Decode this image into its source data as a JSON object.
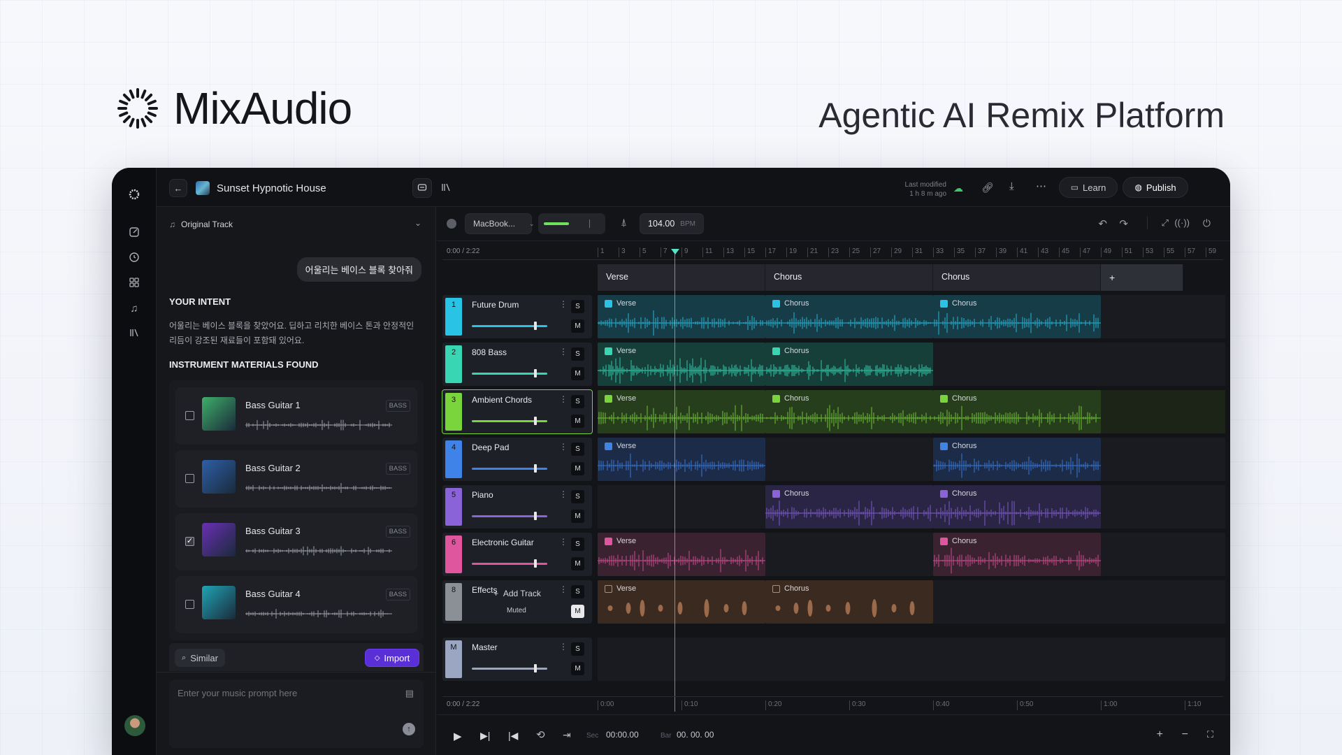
{
  "brand": {
    "name": "MixAudio",
    "tagline": "Agentic AI Remix Platform"
  },
  "topbar": {
    "project_title": "Sunset Hypnotic House",
    "last_modified_label": "Last modified",
    "last_modified_value": "1 h 8 m ago",
    "learn_label": "Learn",
    "publish_label": "Publish"
  },
  "left_pane": {
    "original_track_label": "Original Track",
    "user_message": "어울리는 베이스 블록 찾아줘",
    "intent_heading": "YOUR INTENT",
    "intent_text": "어울리는 베이스 블록을 찾았어요. 딥하고 리치한 베이스 톤과 안정적인 리듬이 강조된 재료들이 포함돼 있어요.",
    "materials_heading": "INSTRUMENT MATERIALS FOUND",
    "materials": [
      {
        "name": "Bass Guitar 1",
        "tag": "BASS",
        "checked": false,
        "color": "#3fae6a"
      },
      {
        "name": "Bass Guitar 2",
        "tag": "BASS",
        "checked": false,
        "color": "#2e5fa8"
      },
      {
        "name": "Bass Guitar 3",
        "tag": "BASS",
        "checked": true,
        "color": "#6a2fb5"
      },
      {
        "name": "Bass Guitar 4",
        "tag": "BASS",
        "checked": false,
        "color": "#1fa4b5"
      }
    ],
    "similar_label": "Similar",
    "import_label": "Import",
    "prompt_placeholder": "Enter your music prompt here"
  },
  "transport_top": {
    "device": "MacBook...",
    "bpm_value": "104.00",
    "bpm_unit": "BPM",
    "master_level": 0.45
  },
  "timeline": {
    "time_top": "0:00 / 2:22",
    "time_bottom": "0:00 / 2:22",
    "bars": [
      "1",
      "3",
      "5",
      "7",
      "9",
      "11",
      "13",
      "15",
      "17",
      "19",
      "21",
      "23",
      "25",
      "27",
      "29",
      "31",
      "33",
      "35",
      "37",
      "39",
      "41",
      "43",
      "45",
      "47",
      "49",
      "51",
      "53",
      "55",
      "57",
      "59"
    ],
    "seconds": [
      "0:00",
      "0:10",
      "0:20",
      "0:30",
      "0:40",
      "0:50",
      "1:00",
      "1:10"
    ],
    "sections": [
      "Verse",
      "Chorus",
      "Chorus"
    ],
    "add_section": "+"
  },
  "tracks": [
    {
      "num": "1",
      "name": "Future Drum",
      "color": "#29c3e6",
      "volume": 0.82
    },
    {
      "num": "2",
      "name": "808 Bass",
      "color": "#38d6b3",
      "volume": 0.82
    },
    {
      "num": "3",
      "name": "Ambient Chords",
      "color": "#7ad43b",
      "volume": 0.82
    },
    {
      "num": "4",
      "name": "Deep Pad",
      "color": "#3f82e8",
      "volume": 0.82
    },
    {
      "num": "5",
      "name": "Piano",
      "color": "#8a63d9",
      "volume": 0.82
    },
    {
      "num": "6",
      "name": "Electronic Guitar",
      "color": "#e0569e",
      "volume": 0.82
    },
    {
      "num": "8",
      "name": "Effects",
      "color": "#8b9097",
      "muted_label": "Muted"
    },
    {
      "num": "M",
      "name": "Master",
      "color": "#9aa6c2",
      "volume": 0.82
    }
  ],
  "track_buttons": {
    "solo": "S",
    "mute": "M"
  },
  "add_track_label": "Add Track",
  "clips": [
    {
      "track": 0,
      "slot": 0,
      "label": "Verse",
      "color": "#29c3e6",
      "bg": "#153c47"
    },
    {
      "track": 0,
      "slot": 1,
      "label": "Chorus",
      "color": "#29c3e6",
      "bg": "#153c47"
    },
    {
      "track": 0,
      "slot": 2,
      "label": "Chorus",
      "color": "#29c3e6",
      "bg": "#153c47"
    },
    {
      "track": 1,
      "slot": 0,
      "label": "Verse",
      "color": "#38d6b3",
      "bg": "#163f3a"
    },
    {
      "track": 1,
      "slot": 1,
      "label": "Chorus",
      "color": "#38d6b3",
      "bg": "#163f3a"
    },
    {
      "track": 2,
      "slot": 0,
      "label": "Verse",
      "color": "#7ad43b",
      "bg": "#273e1c"
    },
    {
      "track": 2,
      "slot": 1,
      "label": "Chorus",
      "color": "#7ad43b",
      "bg": "#273e1c"
    },
    {
      "track": 2,
      "slot": 2,
      "label": "Chorus",
      "color": "#7ad43b",
      "bg": "#273e1c"
    },
    {
      "track": 3,
      "slot": 0,
      "label": "Verse",
      "color": "#3f82e8",
      "bg": "#1b2b48"
    },
    {
      "track": 3,
      "slot": 2,
      "label": "Chorus",
      "color": "#3f82e8",
      "bg": "#1b2b48"
    },
    {
      "track": 4,
      "slot": 1,
      "label": "Chorus",
      "color": "#8a63d9",
      "bg": "#2a2545"
    },
    {
      "track": 4,
      "slot": 2,
      "label": "Chorus",
      "color": "#8a63d9",
      "bg": "#2a2545"
    },
    {
      "track": 5,
      "slot": 0,
      "label": "Verse",
      "color": "#e0569e",
      "bg": "#3a2230"
    },
    {
      "track": 5,
      "slot": 2,
      "label": "Chorus",
      "color": "#e0569e",
      "bg": "#3a2230"
    },
    {
      "track": 6,
      "slot": 0,
      "label": "Verse",
      "color": "#e0813a",
      "bg": "#3b2a20"
    },
    {
      "track": 6,
      "slot": 1,
      "label": "Chorus",
      "color": "#e0813a",
      "bg": "#3b2a20"
    }
  ],
  "transport_bottom": {
    "sec_label": "Sec",
    "sec_value": "00:00.00",
    "bar_label": "Bar",
    "bar_value": "00. 00. 00"
  }
}
